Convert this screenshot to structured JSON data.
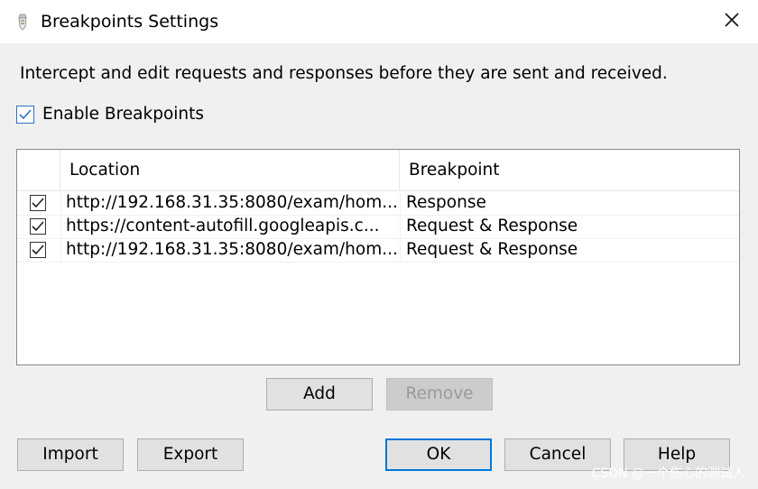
{
  "window": {
    "title": "Breakpoints Settings"
  },
  "intro_text": "Intercept and edit requests and responses before they are sent and received.",
  "enable_checkbox": {
    "label": "Enable Breakpoints",
    "checked": true
  },
  "table": {
    "columns": [
      "",
      "Location",
      "Breakpoint"
    ],
    "rows": [
      {
        "checked": true,
        "location": "http://192.168.31.35:8080/exam/hom...",
        "breakpoint": "Response"
      },
      {
        "checked": true,
        "location": "https://content-autofill.googleapis.c...",
        "breakpoint": "Request & Response"
      },
      {
        "checked": true,
        "location": "http://192.168.31.35:8080/exam/hom...",
        "breakpoint": "Request & Response"
      }
    ]
  },
  "buttons": {
    "add": "Add",
    "remove": "Remove",
    "import": "Import",
    "export": "Export",
    "ok": "OK",
    "cancel": "Cancel",
    "help": "Help"
  },
  "watermark": "CSDN @一个伤心的测试人",
  "colors": {
    "accent": "#0078d7",
    "dialog_bg": "#f0f0f0",
    "titlebar_bg": "#ffffff"
  }
}
